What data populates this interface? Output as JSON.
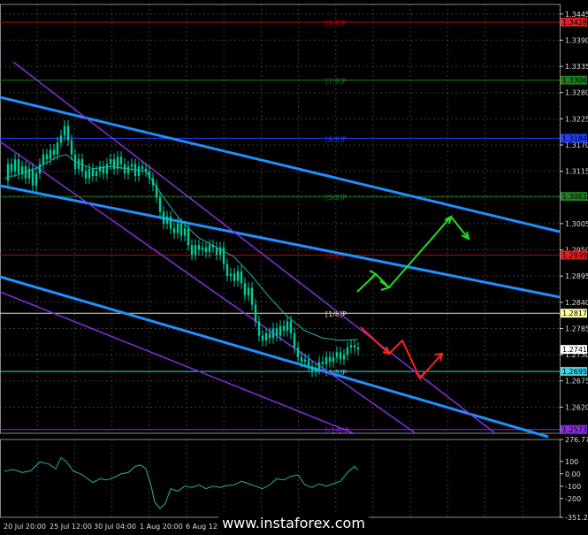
{
  "watermark": "www.instaforex.com",
  "colors": {
    "background": "#000000",
    "grid": "#3a3a3a",
    "candle": "#00cc99",
    "ma": "#20b2aa",
    "channel_blue": "#1e90ff",
    "channel_purple": "#8a2be2",
    "forecast_up": "#22dd22",
    "forecast_down": "#ff2020",
    "indicator": "#20b2aa"
  },
  "chart_data": {
    "type": "line",
    "instrument": "GBP/USD",
    "timeframe": "H4",
    "ylim": [
      1.2565,
      1.3465
    ],
    "x_tick_labels": [
      "20 Jul 20:00",
      "25 Jul 12:00",
      "30 Jul 04:00",
      "1 Aug 20:00",
      "6 Aug 12:00"
    ],
    "y_tick_labels": [
      "1.3445",
      "1.3390",
      "1.3335",
      "1.3280",
      "1.3225",
      "1.3170",
      "1.3115",
      "1.3060",
      "1.3005",
      "1.2950",
      "1.2895",
      "1.2840",
      "1.2785",
      "1.2730",
      "1.2675",
      "1.2620"
    ],
    "price_tags": [
      {
        "value": "1.3428",
        "price": 1.3428,
        "color": "#e02020"
      },
      {
        "value": "1.3306",
        "price": 1.3306,
        "color": "#1f7f1f"
      },
      {
        "value": "1.3184",
        "price": 1.3184,
        "color": "#1f3fff"
      },
      {
        "value": "1.3062",
        "price": 1.3062,
        "color": "#1f7f1f"
      },
      {
        "value": "1.2939",
        "price": 1.2939,
        "color": "#e02020"
      },
      {
        "value": "1.2817",
        "price": 1.2817,
        "color": "#ffffa0"
      },
      {
        "value": "1.2741",
        "price": 1.2741,
        "color": "#ffffff"
      },
      {
        "value": "1.2695",
        "price": 1.2695,
        "color": "#40d0e0"
      },
      {
        "value": "1.2573",
        "price": 1.2573,
        "color": "#8a2be2"
      }
    ],
    "murrey_levels": [
      {
        "label": "[8/8]P",
        "price": 1.3428,
        "color": "#c00000"
      },
      {
        "label": "[7/8]P",
        "price": 1.3306,
        "color": "#1a7a1a"
      },
      {
        "label": "[6/8]P",
        "price": 1.3184,
        "color": "#2040ff"
      },
      {
        "label": "[5/8]P",
        "price": 1.3062,
        "color": "#1a7a1a"
      },
      {
        "label": "[2/8]P",
        "price": 1.2939,
        "color": "#c00000"
      },
      {
        "label": "[1/8]P",
        "price": 1.2817,
        "color": "#e0e0a0"
      },
      {
        "label": "[0/8]P",
        "price": 1.2695,
        "color": "#40d0e0"
      },
      {
        "label": "[-1/8]P",
        "price": 1.2573,
        "color": "#8a2be2"
      }
    ],
    "price_series": [
      [
        0,
        1.3095
      ],
      [
        4,
        1.313
      ],
      [
        8,
        1.3115
      ],
      [
        12,
        1.314
      ],
      [
        16,
        1.311
      ],
      [
        20,
        1.3125
      ],
      [
        24,
        1.31
      ],
      [
        28,
        1.312
      ],
      [
        32,
        1.3085
      ],
      [
        36,
        1.311
      ],
      [
        40,
        1.313
      ],
      [
        44,
        1.315
      ],
      [
        48,
        1.314
      ],
      [
        52,
        1.316
      ],
      [
        56,
        1.315
      ],
      [
        60,
        1.3175
      ],
      [
        64,
        1.319
      ],
      [
        68,
        1.321
      ],
      [
        72,
        1.318
      ],
      [
        76,
        1.315
      ],
      [
        80,
        1.312
      ],
      [
        84,
        1.314
      ],
      [
        88,
        1.3115
      ],
      [
        92,
        1.31
      ],
      [
        96,
        1.312
      ],
      [
        100,
        1.3105
      ],
      [
        104,
        1.3115
      ],
      [
        108,
        1.3125
      ],
      [
        112,
        1.311
      ],
      [
        116,
        1.313
      ],
      [
        120,
        1.314
      ],
      [
        124,
        1.312
      ],
      [
        128,
        1.3145
      ],
      [
        132,
        1.313
      ],
      [
        136,
        1.311
      ],
      [
        140,
        1.3125
      ],
      [
        144,
        1.313
      ],
      [
        148,
        1.3105
      ],
      [
        152,
        1.3125
      ],
      [
        156,
        1.312
      ],
      [
        160,
        1.3115
      ],
      [
        164,
        1.31
      ],
      [
        168,
        1.3085
      ],
      [
        172,
        1.306
      ],
      [
        176,
        1.303
      ],
      [
        180,
        1.3005
      ],
      [
        184,
        1.302
      ],
      [
        188,
        1.2995
      ],
      [
        192,
        1.2985
      ],
      [
        196,
        1.3005
      ],
      [
        200,
        1.298
      ],
      [
        204,
        1.2995
      ],
      [
        208,
        1.296
      ],
      [
        212,
        1.294
      ],
      [
        216,
        1.296
      ],
      [
        220,
        1.295
      ],
      [
        224,
        1.2955
      ],
      [
        228,
        1.2945
      ],
      [
        232,
        1.296
      ],
      [
        236,
        1.2955
      ],
      [
        240,
        1.294
      ],
      [
        244,
        1.2955
      ],
      [
        248,
        1.292
      ],
      [
        252,
        1.2895
      ],
      [
        256,
        1.29
      ],
      [
        260,
        1.2885
      ],
      [
        264,
        1.2905
      ],
      [
        268,
        1.288
      ],
      [
        272,
        1.2855
      ],
      [
        276,
        1.287
      ],
      [
        280,
        1.2835
      ],
      [
        284,
        1.28
      ],
      [
        288,
        1.277
      ],
      [
        292,
        1.276
      ],
      [
        296,
        1.2775
      ],
      [
        300,
        1.2765
      ],
      [
        304,
        1.2785
      ],
      [
        308,
        1.277
      ],
      [
        312,
        1.279
      ],
      [
        316,
        1.278
      ],
      [
        320,
        1.28
      ],
      [
        324,
        1.2775
      ],
      [
        328,
        1.2745
      ],
      [
        332,
        1.2725
      ],
      [
        336,
        1.2715
      ],
      [
        340,
        1.272
      ],
      [
        344,
        1.2705
      ],
      [
        348,
        1.2695
      ],
      [
        352,
        1.27
      ],
      [
        356,
        1.2715
      ],
      [
        360,
        1.271
      ],
      [
        364,
        1.2725
      ],
      [
        368,
        1.2715
      ],
      [
        372,
        1.2725
      ],
      [
        376,
        1.2735
      ],
      [
        380,
        1.272
      ],
      [
        384,
        1.273
      ],
      [
        388,
        1.2745
      ],
      [
        392,
        1.275
      ],
      [
        396,
        1.2745
      ],
      [
        400,
        1.2741
      ]
    ],
    "ma_series": [
      [
        0,
        1.31
      ],
      [
        20,
        1.311
      ],
      [
        40,
        1.3125
      ],
      [
        60,
        1.3145
      ],
      [
        70,
        1.315
      ],
      [
        80,
        1.3135
      ],
      [
        100,
        1.312
      ],
      [
        120,
        1.3125
      ],
      [
        140,
        1.312
      ],
      [
        160,
        1.3115
      ],
      [
        180,
        1.306
      ],
      [
        200,
        1.301
      ],
      [
        220,
        1.2975
      ],
      [
        240,
        1.2955
      ],
      [
        260,
        1.2935
      ],
      [
        280,
        1.2895
      ],
      [
        300,
        1.285
      ],
      [
        320,
        1.281
      ],
      [
        340,
        1.278
      ],
      [
        360,
        1.2765
      ],
      [
        380,
        1.276
      ],
      [
        400,
        1.2762
      ]
    ],
    "oscillator": {
      "ylim": [
        -351.294,
        276.7745
      ],
      "tick_labels": [
        "276.7745",
        "100",
        "0.00",
        "-100",
        "-200",
        "-351.294"
      ],
      "tick_values": [
        276.7745,
        100,
        0,
        -100,
        -200,
        -351.294
      ],
      "series": [
        [
          0,
          20
        ],
        [
          10,
          35
        ],
        [
          20,
          10
        ],
        [
          30,
          25
        ],
        [
          40,
          95
        ],
        [
          50,
          80
        ],
        [
          58,
          40
        ],
        [
          64,
          130
        ],
        [
          70,
          100
        ],
        [
          78,
          20
        ],
        [
          86,
          0
        ],
        [
          94,
          -40
        ],
        [
          100,
          -70
        ],
        [
          108,
          -40
        ],
        [
          116,
          -50
        ],
        [
          124,
          -30
        ],
        [
          132,
          0
        ],
        [
          140,
          10
        ],
        [
          148,
          60
        ],
        [
          154,
          70
        ],
        [
          160,
          40
        ],
        [
          166,
          -100
        ],
        [
          170,
          -230
        ],
        [
          176,
          -280
        ],
        [
          182,
          -240
        ],
        [
          188,
          -120
        ],
        [
          196,
          -140
        ],
        [
          204,
          -100
        ],
        [
          212,
          -110
        ],
        [
          220,
          -90
        ],
        [
          228,
          -120
        ],
        [
          236,
          -100
        ],
        [
          244,
          -110
        ],
        [
          252,
          -95
        ],
        [
          260,
          -90
        ],
        [
          268,
          -60
        ],
        [
          276,
          -80
        ],
        [
          284,
          -100
        ],
        [
          292,
          -120
        ],
        [
          300,
          -90
        ],
        [
          308,
          -40
        ],
        [
          316,
          -50
        ],
        [
          324,
          -20
        ],
        [
          332,
          -10
        ],
        [
          340,
          -90
        ],
        [
          348,
          -110
        ],
        [
          356,
          -80
        ],
        [
          364,
          -100
        ],
        [
          372,
          -80
        ],
        [
          380,
          -60
        ],
        [
          388,
          10
        ],
        [
          396,
          60
        ],
        [
          400,
          30
        ]
      ]
    }
  }
}
